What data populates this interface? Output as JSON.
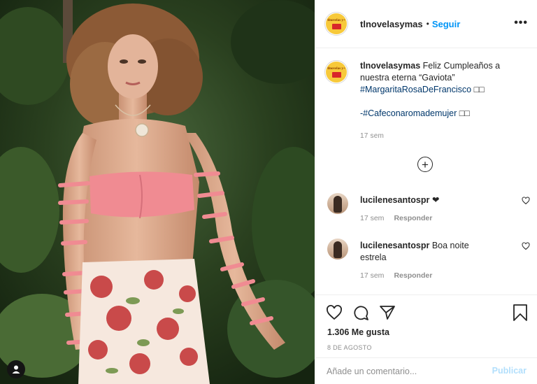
{
  "post": {
    "author": "tlnovelasymas",
    "follow_label": "Seguir",
    "separator": "•",
    "more_label": "•••",
    "logo_text": "tlnovelas y+"
  },
  "caption": {
    "username": "tlnovelasymas",
    "text": "Feliz Cumpleaños a nuestra eterna “Gaviota”",
    "hashtag1": "#MargaritaRosaDeFrancisco",
    "hashtag2": "-#Cafeconaromademujer",
    "emoji": "□□",
    "time": "17 sem"
  },
  "load_more": {
    "label": "+"
  },
  "comments": [
    {
      "username": "lucilenesantospr",
      "text": "❤",
      "time": "17 sem",
      "reply": "Responder"
    },
    {
      "username": "lucilenesantospr",
      "text": "Boa noite estrela",
      "time": "17 sem",
      "reply": "Responder"
    }
  ],
  "actions": {
    "likes": "1.306 Me gusta",
    "date": "8 DE AGOSTO"
  },
  "add_comment": {
    "placeholder": "Añade un comentario...",
    "publish_label": "Publicar"
  },
  "colors": {
    "accent": "#0095f6",
    "publish_disabled": "#b2dffc",
    "muted": "#8e8e8e",
    "text": "#262626",
    "skirt": "#f6e8de",
    "top": "#f08b92"
  }
}
